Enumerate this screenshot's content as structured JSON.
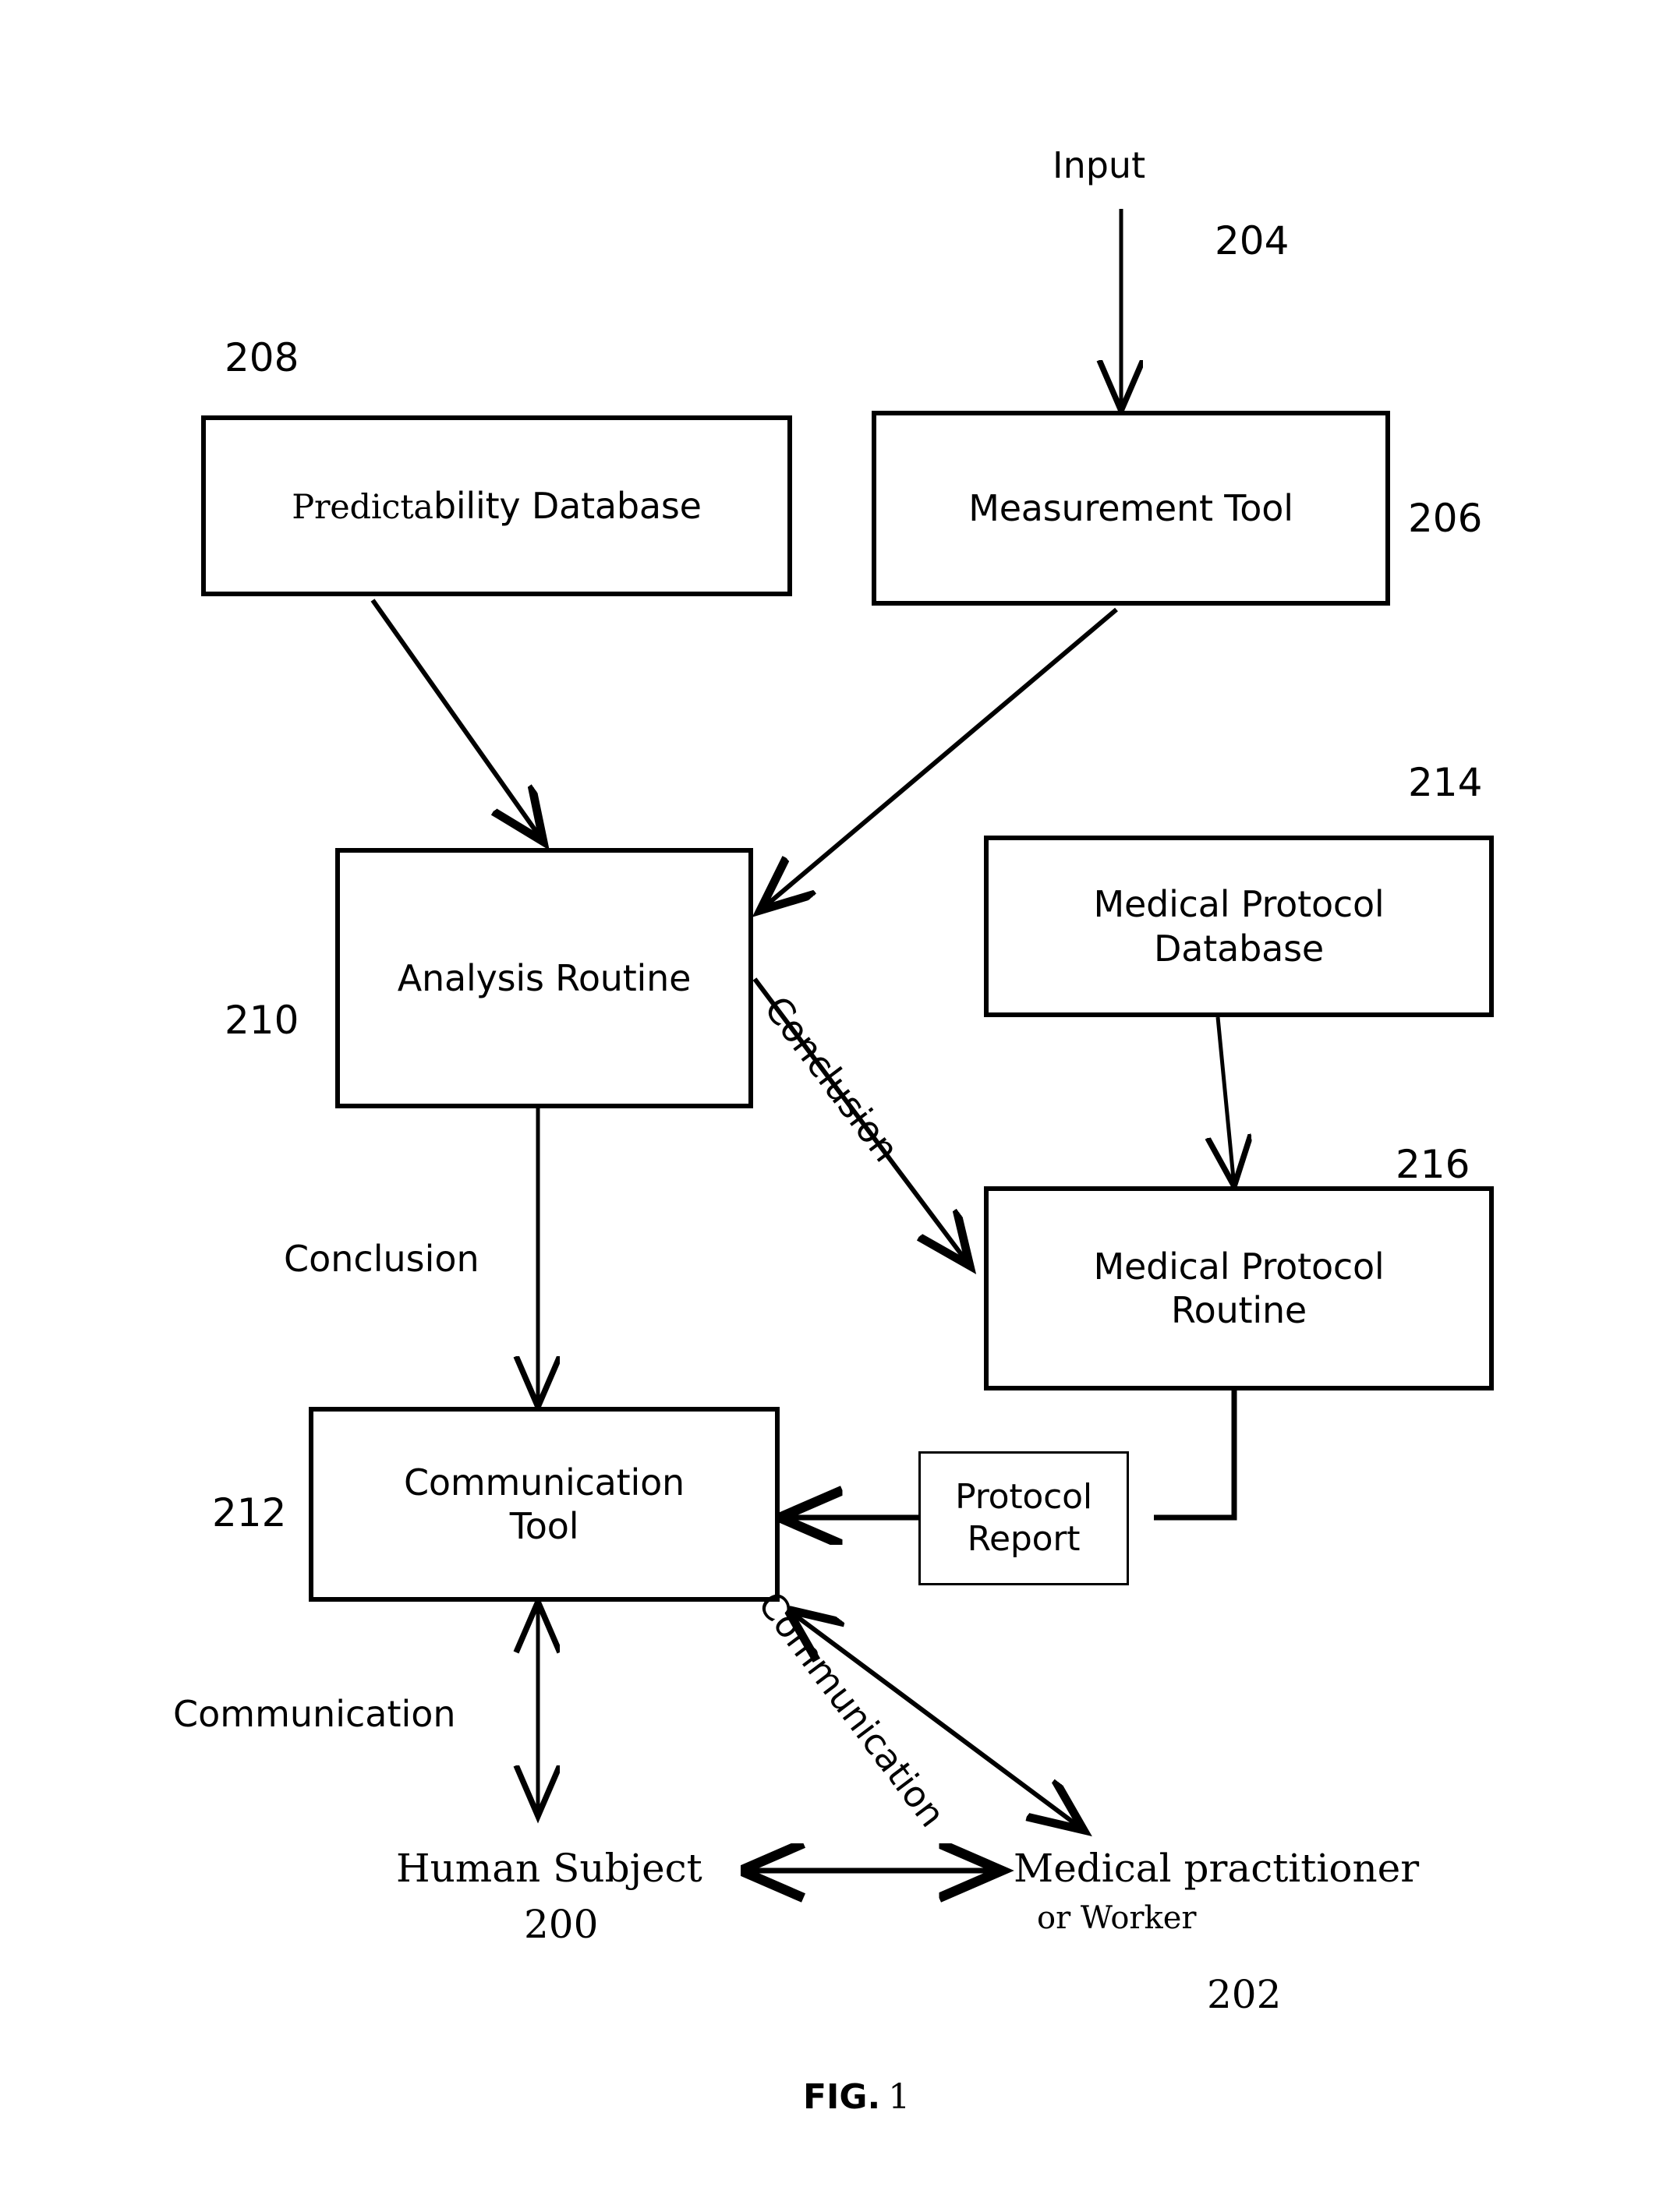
{
  "figure": {
    "caption_word": "FIG.",
    "caption_number": "1",
    "background_color": "#ffffff",
    "stroke_color": "#000000"
  },
  "nodes": {
    "predictability_database": {
      "label": "Predictability Database",
      "label_serif_part": "Predicta",
      "label_sans_part": "bility Database",
      "ref": "208"
    },
    "measurement_tool": {
      "label": "Measurement Tool",
      "ref": "206"
    },
    "analysis_routine": {
      "label": "Analysis Routine",
      "ref": "210"
    },
    "medical_protocol_database": {
      "label": "Medical Protocol\nDatabase",
      "ref": "214"
    },
    "medical_protocol_routine": {
      "label": "Medical Protocol\nRoutine",
      "ref": "216"
    },
    "communication_tool": {
      "label": "Communication\nTool",
      "ref": "212"
    },
    "protocol_report": {
      "label": "Protocol\nReport"
    }
  },
  "actors": {
    "human_subject": {
      "label": "Human Subject",
      "ref": "200"
    },
    "medical_practitioner": {
      "label": "Medical practitioner",
      "sub_label": "or Worker",
      "ref": "202"
    }
  },
  "edge_labels": {
    "input": "Input",
    "input_ref": "204",
    "conclusion_diagonal": "Conclusion",
    "conclusion_vertical": "Conclusion",
    "communication_vertical": "Communication",
    "communication_diagonal": "Communication"
  }
}
